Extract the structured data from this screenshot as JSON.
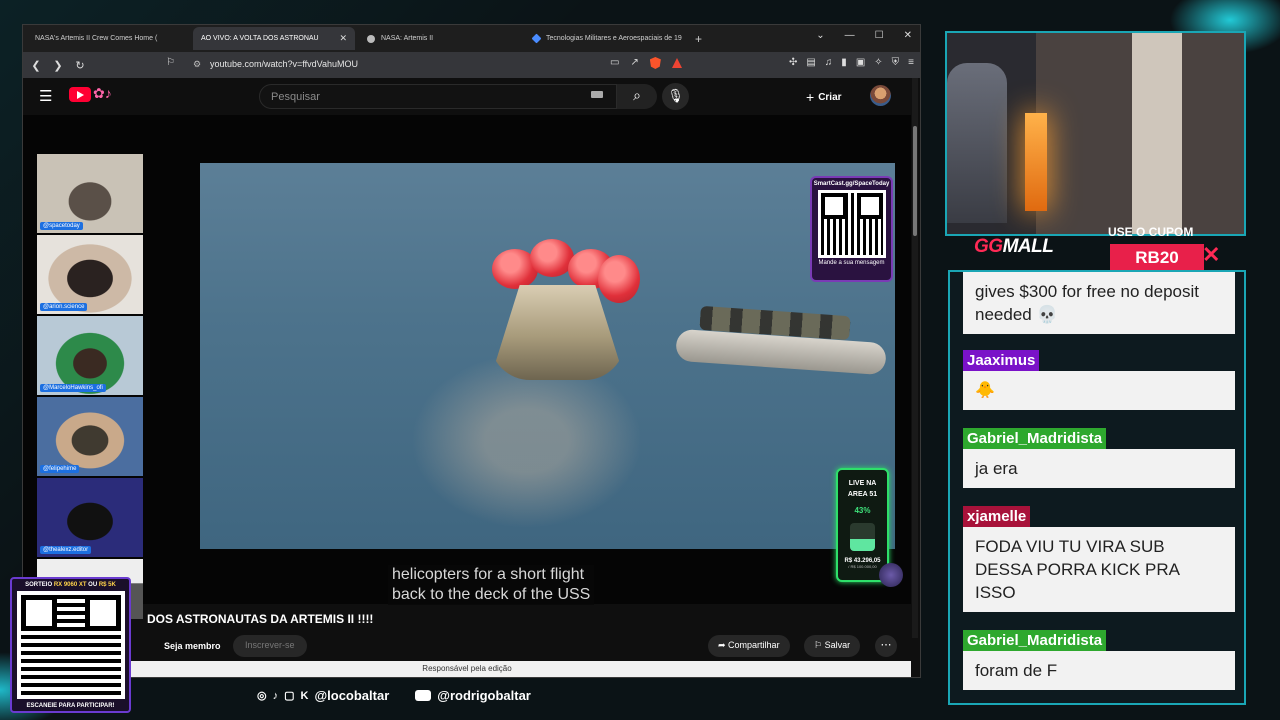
{
  "browser": {
    "tabs": [
      {
        "label": "NASA's Artemis II Crew Comes Home (",
        "icon": "youtube-icon",
        "active": false
      },
      {
        "label": "AO VIVO: A VOLTA DOS ASTRONAU",
        "icon": "youtube-icon",
        "active": true
      },
      {
        "label": "NASA: Artemis II",
        "icon": "nasa-icon",
        "active": false
      },
      {
        "label": "Tecnologias Militares e Aeroespaciais de 19",
        "icon": "gemini-icon",
        "active": false
      }
    ],
    "url": "youtube.com/watch?v=ffvdVahuMOU"
  },
  "youtube": {
    "search_placeholder": "Pesquisar",
    "create_label": "Criar",
    "video_title": "DOS ASTRONAUTAS DA ARTEMIS II !!!!",
    "member_label": "Seja membro",
    "subscribe_label": "Inscrever-se",
    "share_label": "Compartilhar",
    "save_label": "Salvar",
    "editor_notice": "Responsável pela edição",
    "captions": [
      "helicopters for a short flight",
      "back to the deck of the USS"
    ]
  },
  "overlays": {
    "qr_title": "SmartCast.gg/SpaceToday",
    "qr_sub": "Mande a sua mensagem",
    "area51_line1": "LIVE NA",
    "area51_line2": "AREA 51",
    "area51_percent": "43%",
    "area51_progress": 0.43,
    "area51_value": "R$ 43.296,05",
    "area51_goal": "/ R$ 100.000,00"
  },
  "webcams": [
    {
      "handle": "@spacetoday"
    },
    {
      "handle": "@arion.science"
    },
    {
      "handle": "@MarceloHawkins_ofi"
    },
    {
      "handle": "@felipehime"
    },
    {
      "handle": "@thealexz.editor"
    },
    {
      "handle": ""
    }
  ],
  "sponsor": {
    "brand_gg": "GG",
    "brand_rest": "MALL",
    "cupom_label": "USE O CUPOM",
    "code": "RB20"
  },
  "chat": {
    "messages": [
      {
        "user": "",
        "user_color": "",
        "text": "gives $300 for free no deposit needed 💀"
      },
      {
        "user": "Jaaximus",
        "user_color": "#7a12c8",
        "text": "🐥"
      },
      {
        "user": "Gabriel_Madridista",
        "user_color": "#2ea82e",
        "text": "ja era"
      },
      {
        "user": "xjamelle",
        "user_color": "#a8123a",
        "text": "FODA VIU TU VIRA SUB DESSA PORRA KICK PRA ISSO"
      },
      {
        "user": "Gabriel_Madridista",
        "user_color": "#2ea82e",
        "text": "foram de F"
      }
    ]
  },
  "socials": {
    "handle1": "@locobaltar",
    "handle2": "@rodrigobaltar"
  },
  "raffle": {
    "head_pre": "SORTEIO",
    "head_item1": "RX 9060 XT",
    "head_mid": "OU",
    "head_item2": "R$ 5K",
    "foot": "ESCANEIE PARA PARTICIPAR!"
  }
}
